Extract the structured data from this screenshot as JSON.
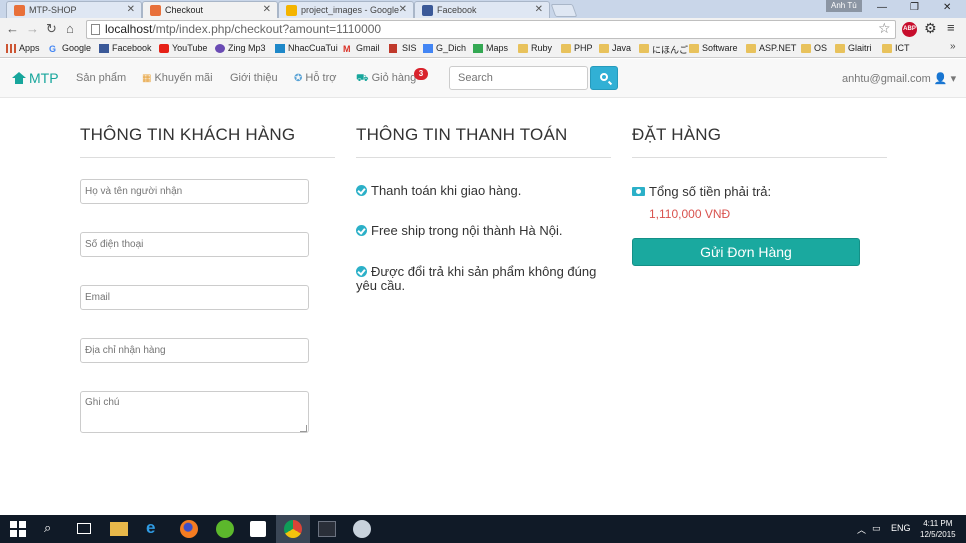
{
  "browser": {
    "tabs": [
      {
        "label": "MTP-SHOP",
        "active": false
      },
      {
        "label": "Checkout",
        "active": true
      },
      {
        "label": "project_images - Google",
        "active": false
      },
      {
        "label": "Facebook",
        "active": false
      }
    ],
    "user_chip": "Anh Tú",
    "url_host": "localhost",
    "url_path": "/mtp/index.php/checkout?amount=1110000",
    "abp_label": "ABP",
    "bookmarks": [
      "Apps",
      "Google",
      "Facebook",
      "YouTube",
      "Zing Mp3",
      "NhacCuaTui",
      "Gmail",
      "SIS",
      "G_Dich",
      "Maps",
      "Ruby",
      "PHP",
      "Java",
      "にほんご",
      "Software",
      "ASP.NET",
      "OS",
      "Glaitri",
      "ICT"
    ]
  },
  "navbar": {
    "brand": "MTP",
    "links": [
      "Sản phẩm",
      "Khuyến mãi",
      "Giới thiệu",
      "Hỗ trợ",
      "Giỏ hàng"
    ],
    "cart_count": "3",
    "search_placeholder": "Search",
    "user_email": "anhtu@gmail.com"
  },
  "customer": {
    "title": "THÔNG TIN KHÁCH HÀNG",
    "name_placeholder": "Họ và tên người nhận",
    "phone_placeholder": "Số điện thoại",
    "email_placeholder": "Email",
    "address_placeholder": "Địa chỉ nhận hàng",
    "note_placeholder": "Ghi chú"
  },
  "payment": {
    "title": "THÔNG TIN THANH TOÁN",
    "items": [
      "Thanh toán khi giao hàng.",
      "Free ship trong nội thành Hà Nội.",
      "Được đổi trả khi sản phẩm không đúng yêu cầu."
    ]
  },
  "order": {
    "title": "ĐẶT HÀNG",
    "total_label": "Tổng số tiền phải trả:",
    "total_value": "1,110,000 VNĐ",
    "submit_label": "Gửi Đơn Hàng"
  },
  "taskbar": {
    "language": "ENG",
    "time": "4:11 PM",
    "date": "12/5/2015"
  },
  "colors": {
    "brand": "#17a69c",
    "submit": "#1aa99f",
    "badge": "#d9232d",
    "total": "#d9534f",
    "check": "#2bb0c8"
  }
}
